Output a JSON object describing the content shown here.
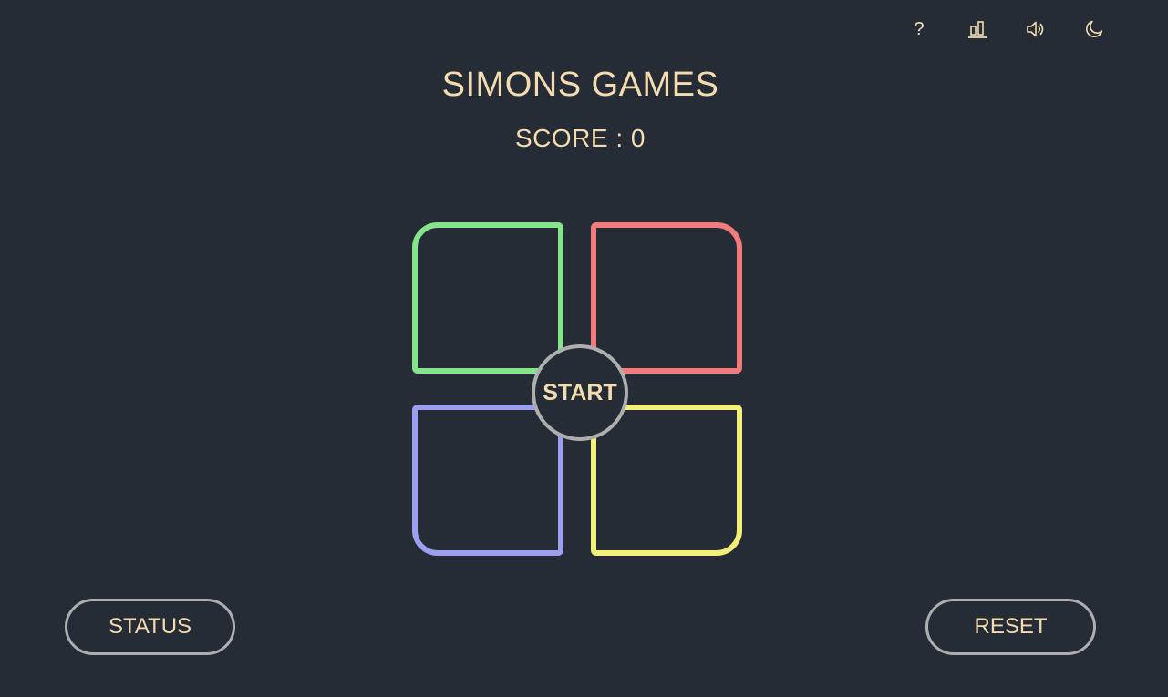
{
  "toolbar": {
    "help_label": "?",
    "icons": [
      "help-icon",
      "leaderboard-icon",
      "volume-icon",
      "dark-mode-icon"
    ]
  },
  "game": {
    "title": "SIMONS GAMES",
    "score_label": "SCORE : 0",
    "start_label": "START"
  },
  "pads": {
    "green": "#86e58a",
    "red": "#f27c7c",
    "blue": "#9b9ff0",
    "yellow": "#f2ef7a"
  },
  "buttons": {
    "status_label": "STATUS",
    "reset_label": "RESET"
  },
  "colors": {
    "background": "#252c36",
    "text": "#f4dcb0",
    "outline": "#aeaeae"
  }
}
